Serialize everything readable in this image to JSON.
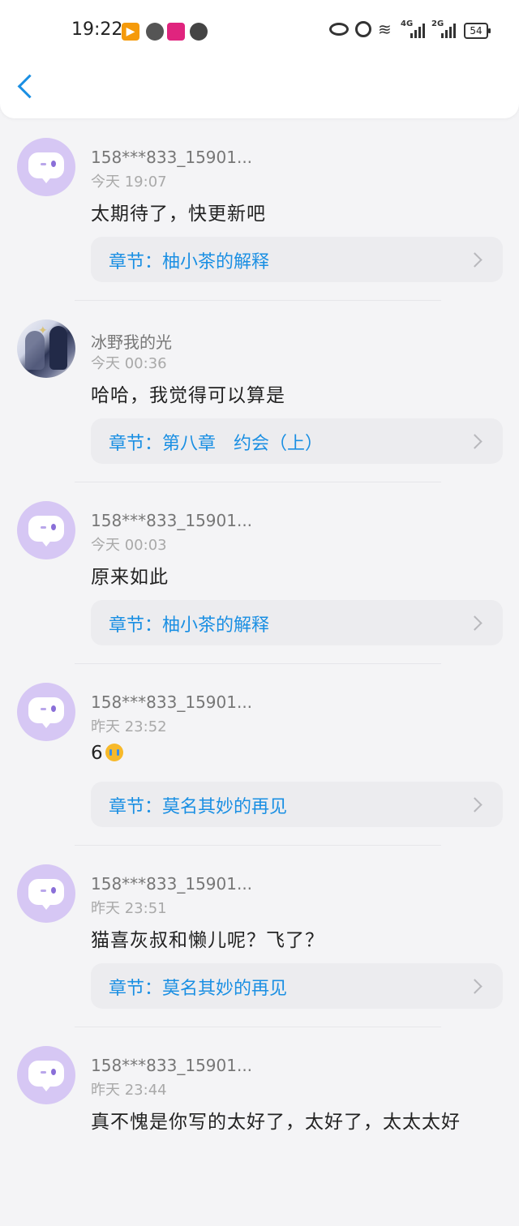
{
  "status_bar": {
    "time": "19:22",
    "net1": "4G",
    "net2": "2G",
    "battery": "54",
    "icons": [
      "play-app-icon",
      "ball-app-icon",
      "pink-app-icon",
      "chat-app-icon",
      "eye-icon",
      "alarm-icon",
      "wifi-icon",
      "signal-icon",
      "battery-icon"
    ]
  },
  "header": {
    "back_icon": "chevron-left-icon",
    "accent_color": "#1a8fe3"
  },
  "comments": [
    {
      "user": "158***833_15901...",
      "time": "今天 19:07",
      "text": "太期待了，快更新吧",
      "chapter": "章节：柚小茶的解释",
      "avatar": "default"
    },
    {
      "user": "冰野我的光",
      "time": "今天 00:36",
      "text": "哈哈，我觉得可以算是",
      "chapter": "章节：第八章　约会（上）",
      "avatar": "photo"
    },
    {
      "user": "158***833_15901...",
      "time": "今天 00:03",
      "text": "原来如此",
      "chapter": "章节：柚小茶的解释",
      "avatar": "default"
    },
    {
      "user": "158***833_15901...",
      "time": "昨天 23:52",
      "text": "6",
      "chapter": "章节：莫名其妙的再见",
      "avatar": "default",
      "emoji": "crying-face-emoji"
    },
    {
      "user": "158***833_15901...",
      "time": "昨天 23:51",
      "text": "猫喜灰叔和懒儿呢？飞了？",
      "chapter": "章节：莫名其妙的再见",
      "avatar": "default"
    },
    {
      "user": "158***833_15901...",
      "time": "昨天 23:44",
      "text": "真不愧是你写的太好了，太好了，太太太好",
      "chapter": "",
      "avatar": "default"
    }
  ]
}
